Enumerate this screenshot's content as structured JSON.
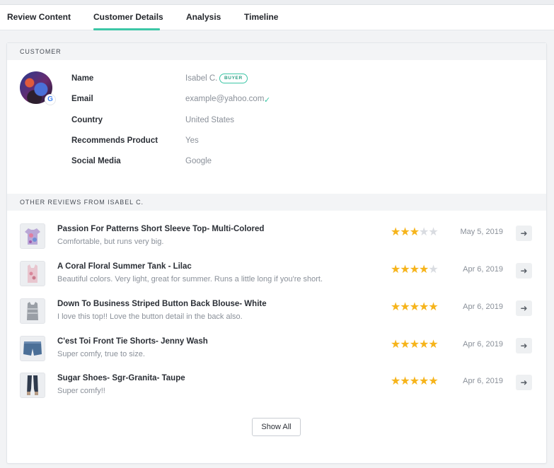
{
  "tabs": [
    {
      "label": "Review Content"
    },
    {
      "label": "Customer Details"
    },
    {
      "label": "Analysis"
    },
    {
      "label": "Timeline"
    }
  ],
  "active_tab": "Customer Details",
  "customer": {
    "section_title": "CUSTOMER",
    "badge": "BUYER",
    "social_icon": "google-icon",
    "fields": [
      {
        "label": "Name",
        "value": "Isabel C."
      },
      {
        "label": "Email",
        "value": "example@yahoo.com"
      },
      {
        "label": "Country",
        "value": "United States"
      },
      {
        "label": "Recommends Product",
        "value": "Yes"
      },
      {
        "label": "Social Media",
        "value": "Google"
      }
    ]
  },
  "other_reviews": {
    "section_title": "OTHER REVIEWS FROM ISABEL C.",
    "items": [
      {
        "title": "Passion For Patterns Short Sleeve Top- Multi-Colored",
        "text": "Comfortable, but runs very big.",
        "rating": 3,
        "date": "May 5, 2019"
      },
      {
        "title": "A Coral Floral Summer Tank - Lilac",
        "text": "Beautiful colors. Very light, great for summer. Runs a little long if you're short.",
        "rating": 4,
        "date": "Apr 6, 2019"
      },
      {
        "title": "Down To Business Striped Button Back Blouse- White",
        "text": "I love this top!! Love the button detail in the back also.",
        "rating": 5,
        "date": "Apr 6, 2019"
      },
      {
        "title": "C'est Toi Front Tie Shorts- Jenny Wash",
        "text": "Super comfy, true to size.",
        "rating": 5,
        "date": "Apr 6, 2019"
      },
      {
        "title": "Sugar Shoes- Sgr-Granita- Taupe",
        "text": "Super comfy!!",
        "rating": 5,
        "date": "Apr 6, 2019"
      }
    ],
    "show_all_label": "Show All"
  },
  "colors": {
    "accent": "#3cc6a6",
    "star": "#f6b41b",
    "star_empty": "#d9dce1"
  }
}
